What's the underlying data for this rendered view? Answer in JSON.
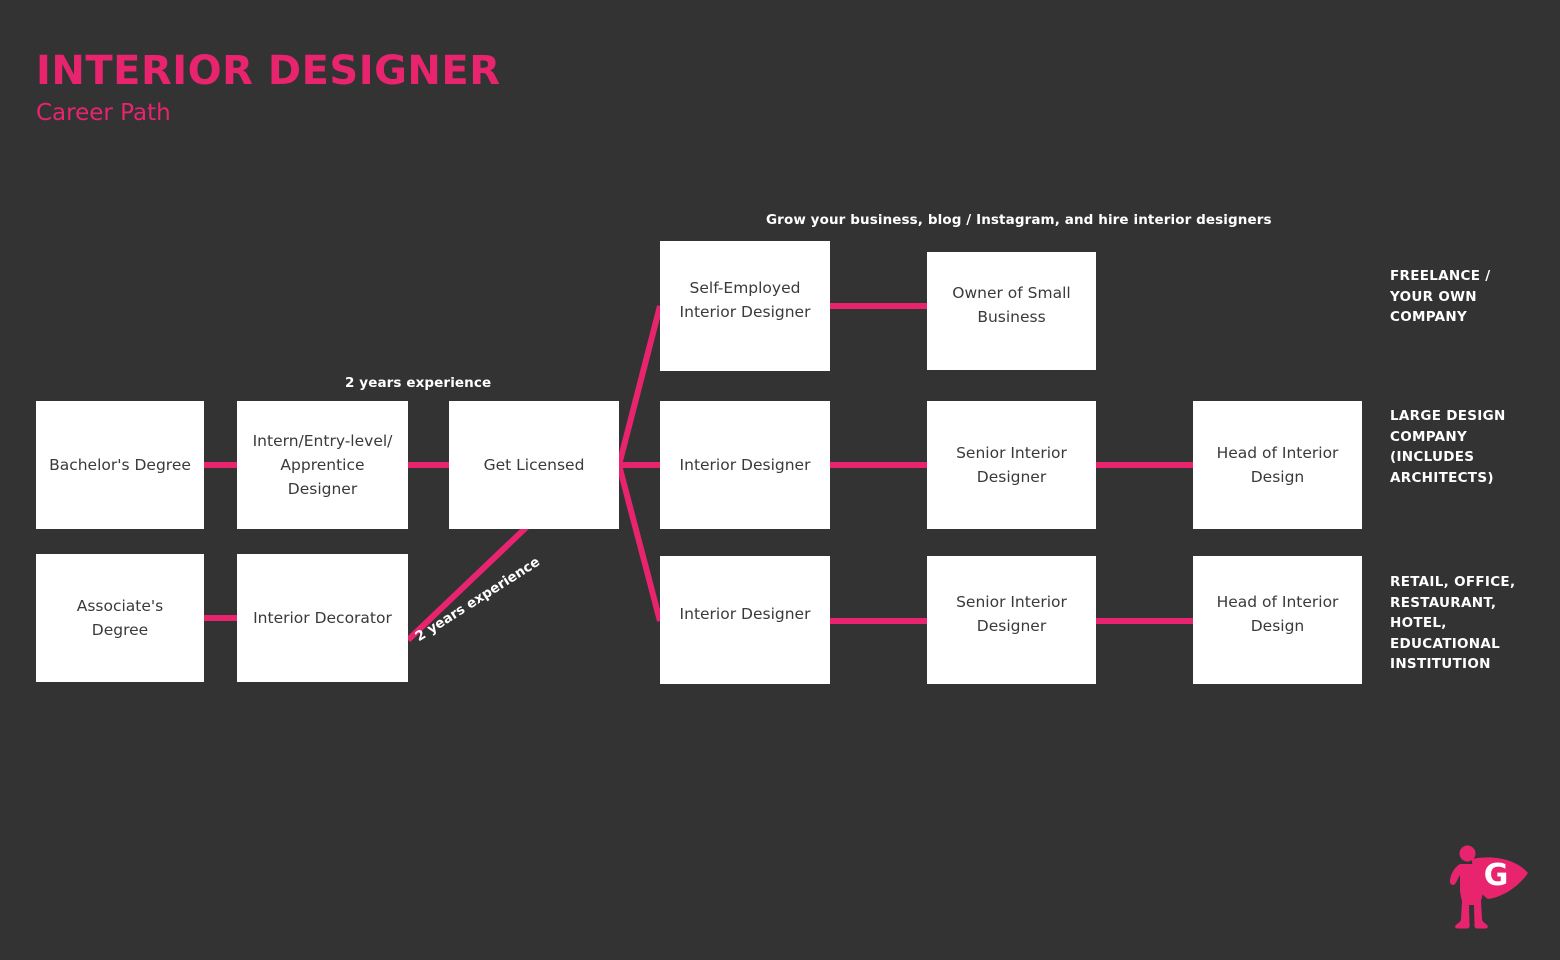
{
  "header": {
    "title": "INTERIOR DESIGNER",
    "subtitle": "Career Path"
  },
  "theme": {
    "background": "#333333",
    "accent": "#E8246E",
    "node_fill": "#FFFFFF",
    "node_text": "#3A3A3A",
    "annotation_text": "#FFFFFF"
  },
  "annotations": {
    "grow_business": "Grow your business, blog / Instagram, and hire interior designers",
    "two_years_top": "2 years experience",
    "two_years_diagonal": "2 years experience"
  },
  "nodes": {
    "bachelors_degree": "Bachelor's Degree",
    "intern_entry_apprentice": "Intern/Entry-level/\nApprentice\nDesigner",
    "get_licensed": "Get Licensed",
    "associates_degree": "Associate's Degree",
    "interior_decorator": "Interior Decorator",
    "self_employed_interior_designer": "Self-Employed\nInterior Designer",
    "owner_of_small_business": "Owner of Small\nBusiness",
    "interior_designer_mid": "Interior Designer",
    "senior_interior_designer_mid": "Senior Interior\nDesigner",
    "head_of_interior_design_mid": "Head of Interior\nDesign",
    "interior_designer_bottom": "Interior Designer",
    "senior_interior_designer_bottom": "Senior Interior\nDesigner",
    "head_of_interior_design_bottom": "Head of Interior\nDesign"
  },
  "categories": {
    "freelance": "FREELANCE /\nYOUR OWN\nCOMPANY",
    "large_design": "LARGE DESIGN\nCOMPANY\n(INCLUDES\nARCHITECTS)",
    "retail_office": "RETAIL, OFFICE,\nRESTAURANT,\nHOTEL,\nEDUCATIONAL\nINSTITUTION"
  },
  "logo": {
    "letter": "G",
    "color": "#E8246E"
  }
}
